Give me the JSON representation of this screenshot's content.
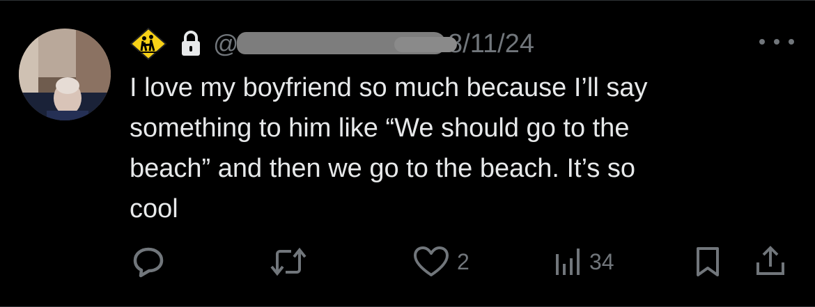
{
  "tweet": {
    "handle_prefix": "@",
    "date": "8/11/24",
    "text": "I love my boyfriend so much because I’ll say\nsomething to him like “We should go to the\nbeach” and then we go to the beach. It’s so\ncool",
    "badge_icon": "pedestrian-crossing-sign-icon",
    "lock_icon": "lock-icon",
    "more_icon": "more-horizontal-icon"
  },
  "actions": {
    "reply": {
      "icon": "reply-icon"
    },
    "retweet": {
      "icon": "retweet-icon"
    },
    "like": {
      "icon": "heart-icon",
      "count": "2"
    },
    "views": {
      "icon": "views-chart-icon",
      "count": "34"
    },
    "bookmark": {
      "icon": "bookmark-icon"
    },
    "share": {
      "icon": "share-icon"
    }
  },
  "colors": {
    "background": "#000000",
    "text": "#e7e9ea",
    "secondary": "#71767b",
    "badge_yellow": "#f7d117"
  }
}
